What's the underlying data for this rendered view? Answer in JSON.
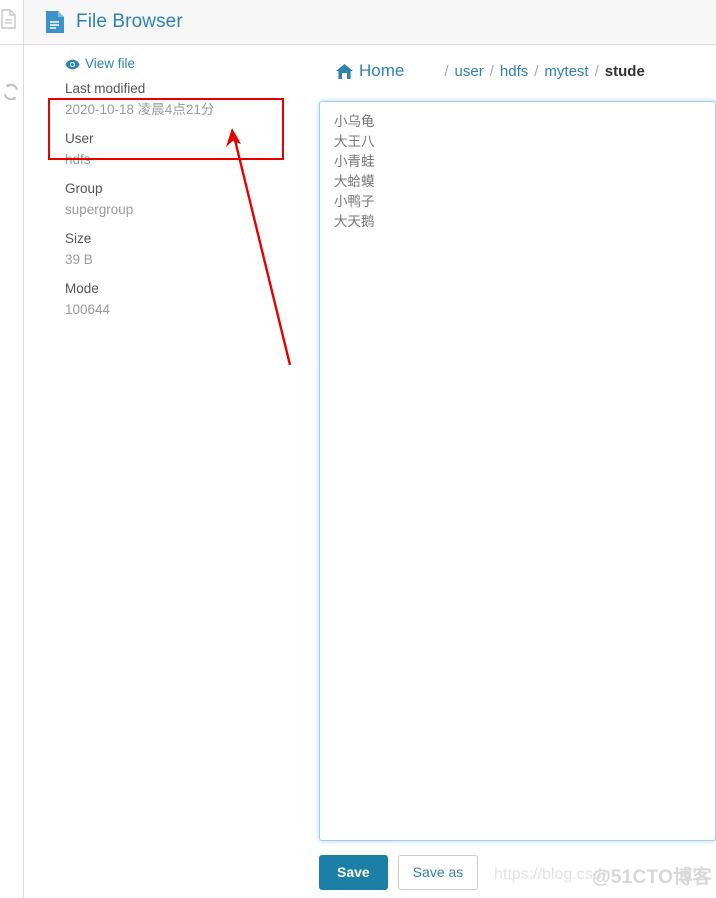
{
  "window": {
    "title": "File Browser",
    "title_icon": "file-document-icon",
    "header_bg": "#f7f7f7",
    "accent": "#2e84b0"
  },
  "rail": {
    "doc_icon": "document-icon",
    "refresh_icon": "refresh-icon"
  },
  "file_panel": {
    "view_file_label": "View file",
    "view_file_icon": "eye-icon",
    "metadata": [
      {
        "label": "Last modified",
        "value": "2020-10-18 凌晨4点21分"
      },
      {
        "label": "User",
        "value": "hdfs"
      },
      {
        "label": "Group",
        "value": "supergroup"
      },
      {
        "label": "Size",
        "value": "39 B"
      },
      {
        "label": "Mode",
        "value": "100644"
      }
    ]
  },
  "annotation": {
    "box_color": "#e60000",
    "arrow_color": "#e60000",
    "target": "Last modified"
  },
  "breadcrumb": {
    "home_label": "Home",
    "home_icon": "home-icon",
    "separator": "/",
    "items": [
      {
        "label": "user",
        "current": false
      },
      {
        "label": "hdfs",
        "current": false
      },
      {
        "label": "mytest",
        "current": false
      },
      {
        "label": "stude",
        "current": true
      }
    ]
  },
  "editor": {
    "value": "小乌龟\n大王八\n小青蛙\n大蛤蟆\n小鸭子\n大天鹅",
    "placeholder": "",
    "focused": true,
    "border_color": "#9fd0ea"
  },
  "actions": {
    "save_label": "Save",
    "save_as_label": "Save as",
    "primary_color": "#1b7fa8"
  },
  "watermarks": {
    "csdn": "https://blog.csdn",
    "cto": "@51CTO博客"
  }
}
